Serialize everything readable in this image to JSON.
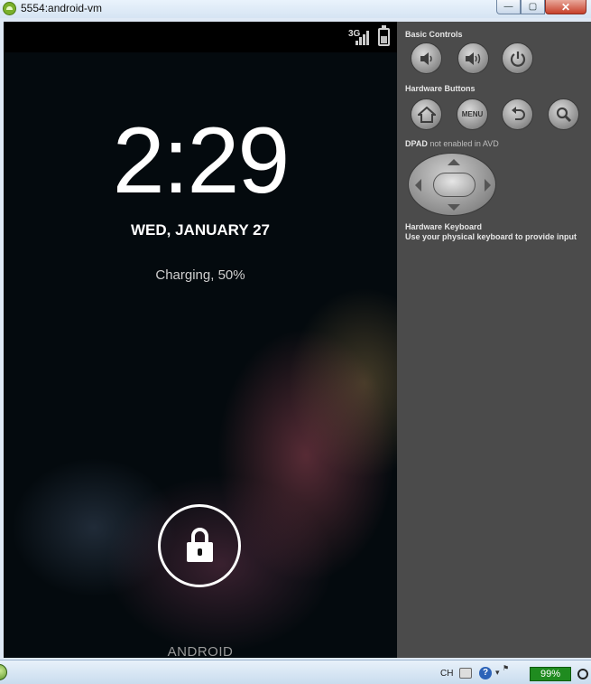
{
  "window": {
    "title": "5554:android-vm",
    "minimize_label": "—",
    "maximize_label": "▢",
    "close_label": "✕"
  },
  "statusbar": {
    "network_type": "3G"
  },
  "lockscreen": {
    "time": "2:29",
    "date": "WED, JANUARY 27",
    "charging_status": "Charging, 50%",
    "carrier": "ANDROID"
  },
  "controls_panel": {
    "basic_controls_label": "Basic Controls",
    "hardware_buttons_label": "Hardware Buttons",
    "menu_button_label": "MENU",
    "dpad_label": "DPAD",
    "dpad_status": "not enabled in AVD",
    "hardware_keyboard_label": "Hardware Keyboard",
    "hardware_keyboard_hint": "Use your physical keyboard to provide input",
    "icons": {
      "volume_down": "volume-down-icon",
      "volume_up": "volume-up-icon",
      "power": "power-icon",
      "home": "home-icon",
      "back": "back-icon",
      "search": "search-icon"
    }
  },
  "taskbar": {
    "language": "CH",
    "battery_percent": "99%"
  },
  "colors": {
    "panel_bg": "#4b4b4b",
    "screen_bg": "#040a0e",
    "battery_badge": "#1f8b1f"
  }
}
